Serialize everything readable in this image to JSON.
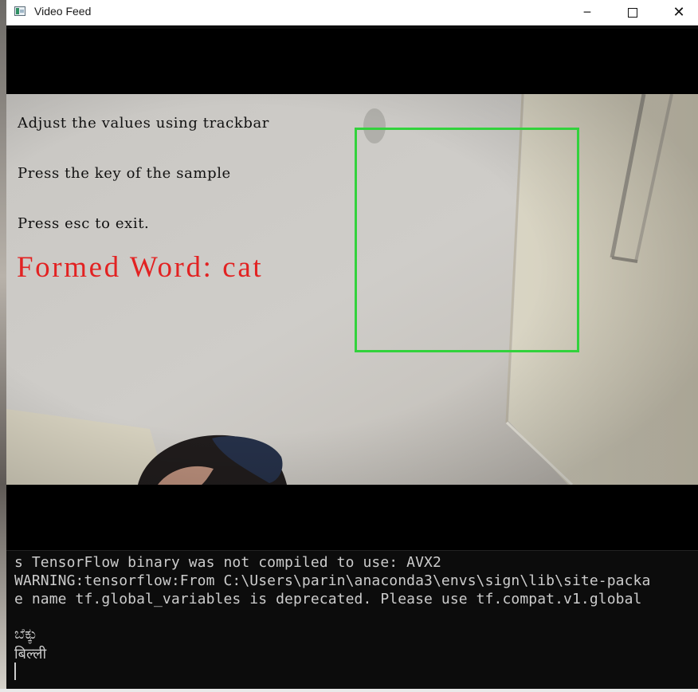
{
  "window": {
    "title": "Video Feed",
    "icon": "app-window-icon",
    "controls": {
      "minimize": "─",
      "close": "✕"
    }
  },
  "video": {
    "overlay": {
      "line1": "Adjust the values using trackbar",
      "line2": "Press the key of the sample",
      "line3": "Press esc to exit.",
      "formed_word": "Formed Word: cat",
      "formed_word_color": "#e22222",
      "roi_box_color": "#32d23c"
    }
  },
  "console": {
    "lines": [
      "s TensorFlow binary was not compiled to use: AVX2",
      "WARNING:tensorflow:From C:\\Users\\parin\\anaconda3\\envs\\sign\\lib\\site-packa",
      "e name tf.global_variables is deprecated. Please use tf.compat.v1.global",
      "ಬೆಕ್ಕು",
      "बिल्ली"
    ]
  }
}
